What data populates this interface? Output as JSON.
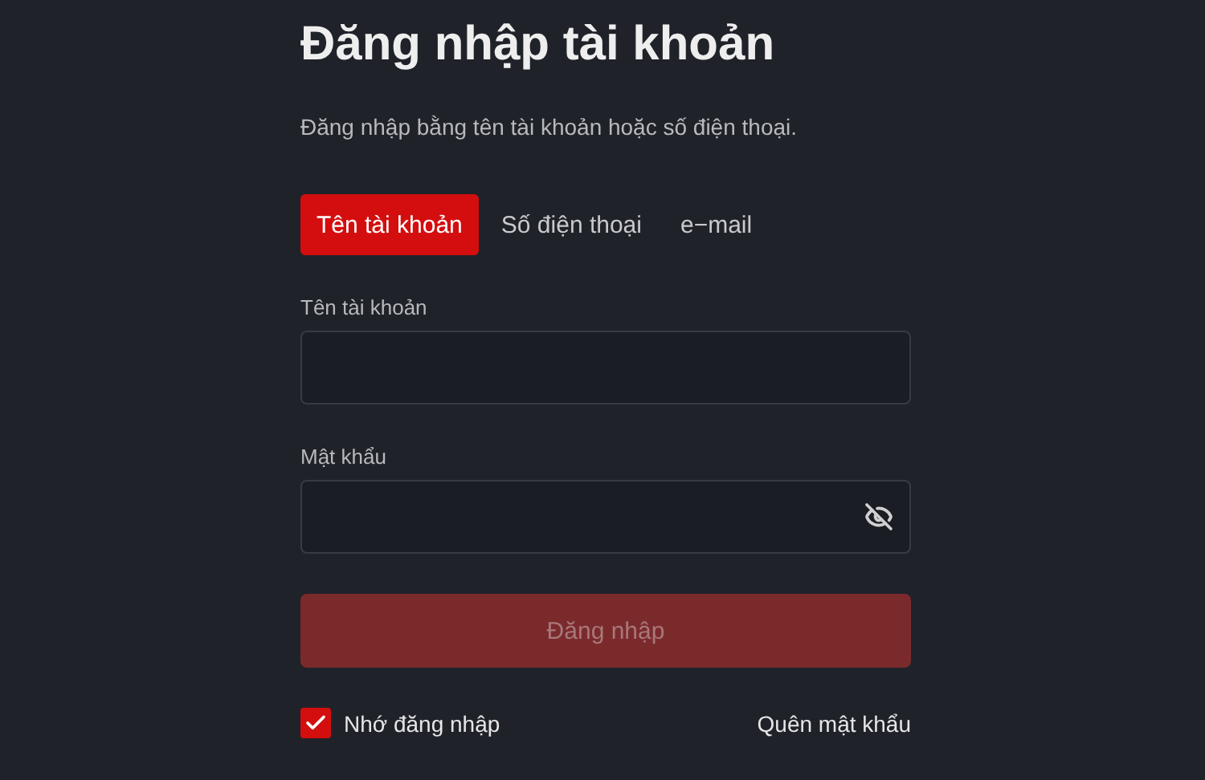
{
  "title": "Đăng nhập tài khoản",
  "subtitle": "Đăng nhập bằng tên tài khoản hoặc số điện thoại.",
  "tabs": [
    {
      "label": "Tên tài khoản",
      "selected": true
    },
    {
      "label": "Số điện thoại",
      "selected": false
    },
    {
      "label": "e−mail",
      "selected": false
    }
  ],
  "fields": [
    {
      "label": "Tên tài khoản",
      "kind": "text"
    },
    {
      "label": "Mật khẩu",
      "kind": "password"
    }
  ],
  "submit": {
    "label": "Đăng nhập",
    "disabled": true
  },
  "remember": {
    "label": "Nhớ đăng nhập",
    "checked": true
  },
  "forgot": "Quên mật khẩu"
}
